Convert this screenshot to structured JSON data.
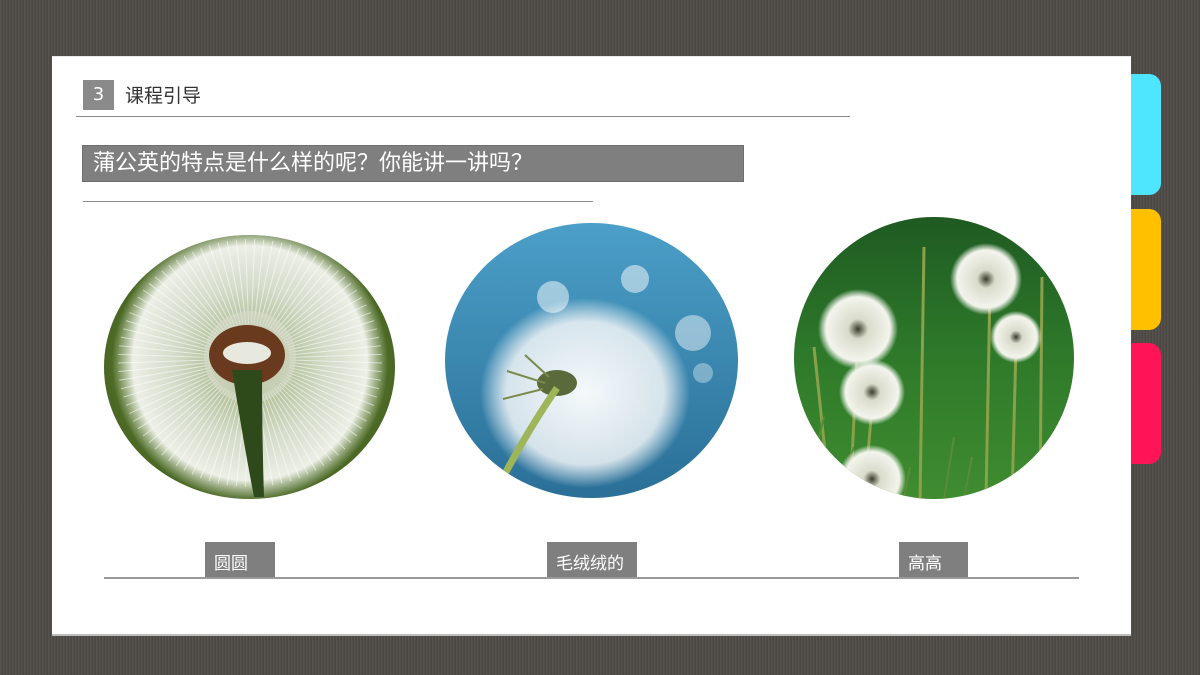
{
  "side_tabs": [
    {
      "name": "cyan",
      "color": "#4ee6ff"
    },
    {
      "name": "yellow",
      "color": "#ffc000"
    },
    {
      "name": "pink",
      "color": "#ff1457"
    }
  ],
  "header": {
    "section_number": "3",
    "section_title": "课程引导"
  },
  "question": "蒲公英的特点是什么样的呢？你能讲一讲吗？",
  "photos": [
    {
      "subject": "dandelion-seed-head-closeup",
      "label": "圆圆"
    },
    {
      "subject": "dandelion-seeds-blowing",
      "label": "毛绒绒的"
    },
    {
      "subject": "dandelions-in-grass",
      "label": "高高"
    }
  ]
}
